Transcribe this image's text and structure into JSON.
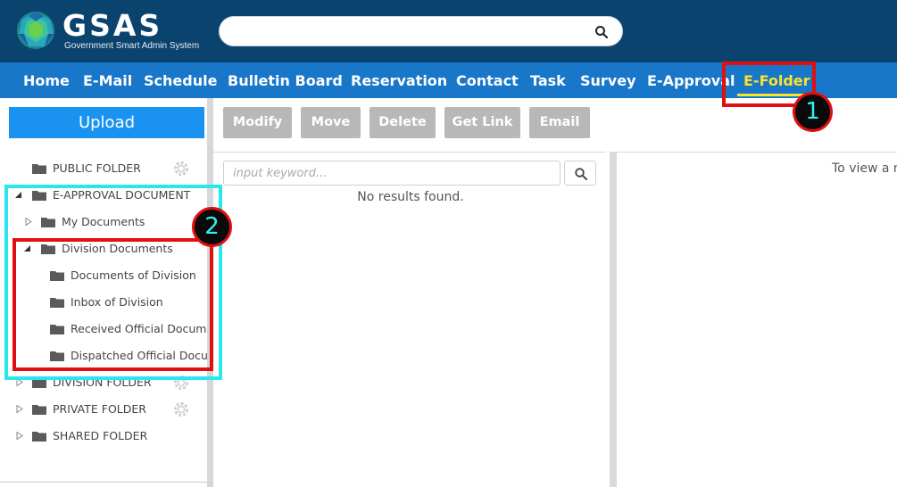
{
  "header": {
    "logo_text": "GSAS",
    "logo_subtitle": "Government Smart Admin System",
    "search_value": ""
  },
  "nav": {
    "items": [
      {
        "label": "Home"
      },
      {
        "label": "E-Mail"
      },
      {
        "label": "Schedule"
      },
      {
        "label": "Bulletin Board"
      },
      {
        "label": "Reservation"
      },
      {
        "label": "Contact"
      },
      {
        "label": "Task"
      },
      {
        "label": "Survey"
      },
      {
        "label": "E-Approval"
      },
      {
        "label": "E-Folder"
      }
    ],
    "active": "E-Folder"
  },
  "sidebar": {
    "upload_label": "Upload",
    "tree": [
      {
        "label": "PUBLIC FOLDER",
        "has_gear": true
      },
      {
        "label": "E-APPROVAL DOCUMENT",
        "expanded": true
      },
      {
        "label": "My Documents"
      },
      {
        "label": "Division Documents",
        "expanded": true
      },
      {
        "label": "Documents of Division"
      },
      {
        "label": "Inbox of Division"
      },
      {
        "label": "Received Official Documents"
      },
      {
        "label": "Dispatched Official Documents"
      },
      {
        "label": "DIVISION FOLDER",
        "has_gear": true
      },
      {
        "label": "PRIVATE FOLDER",
        "has_gear": true
      },
      {
        "label": "SHARED FOLDER"
      }
    ]
  },
  "toolbar": {
    "modify": "Modify",
    "move": "Move",
    "delete": "Delete",
    "get_link": "Get Link",
    "email": "Email"
  },
  "list": {
    "keyword_placeholder": "input keyword...",
    "keyword_value": "",
    "empty_message": "No results found."
  },
  "preview": {
    "hint": "To view a m"
  },
  "annotations": {
    "badge1": "1",
    "badge2": "2"
  },
  "colors": {
    "header_bg": "#0b436f",
    "nav_bg": "#1877c9",
    "active_nav": "#ffe22d",
    "upload_bg": "#1a93f0",
    "toolbar_btn": "#b8b8b8",
    "annotation_red": "#e01010",
    "annotation_cyan": "#28e8ee"
  }
}
